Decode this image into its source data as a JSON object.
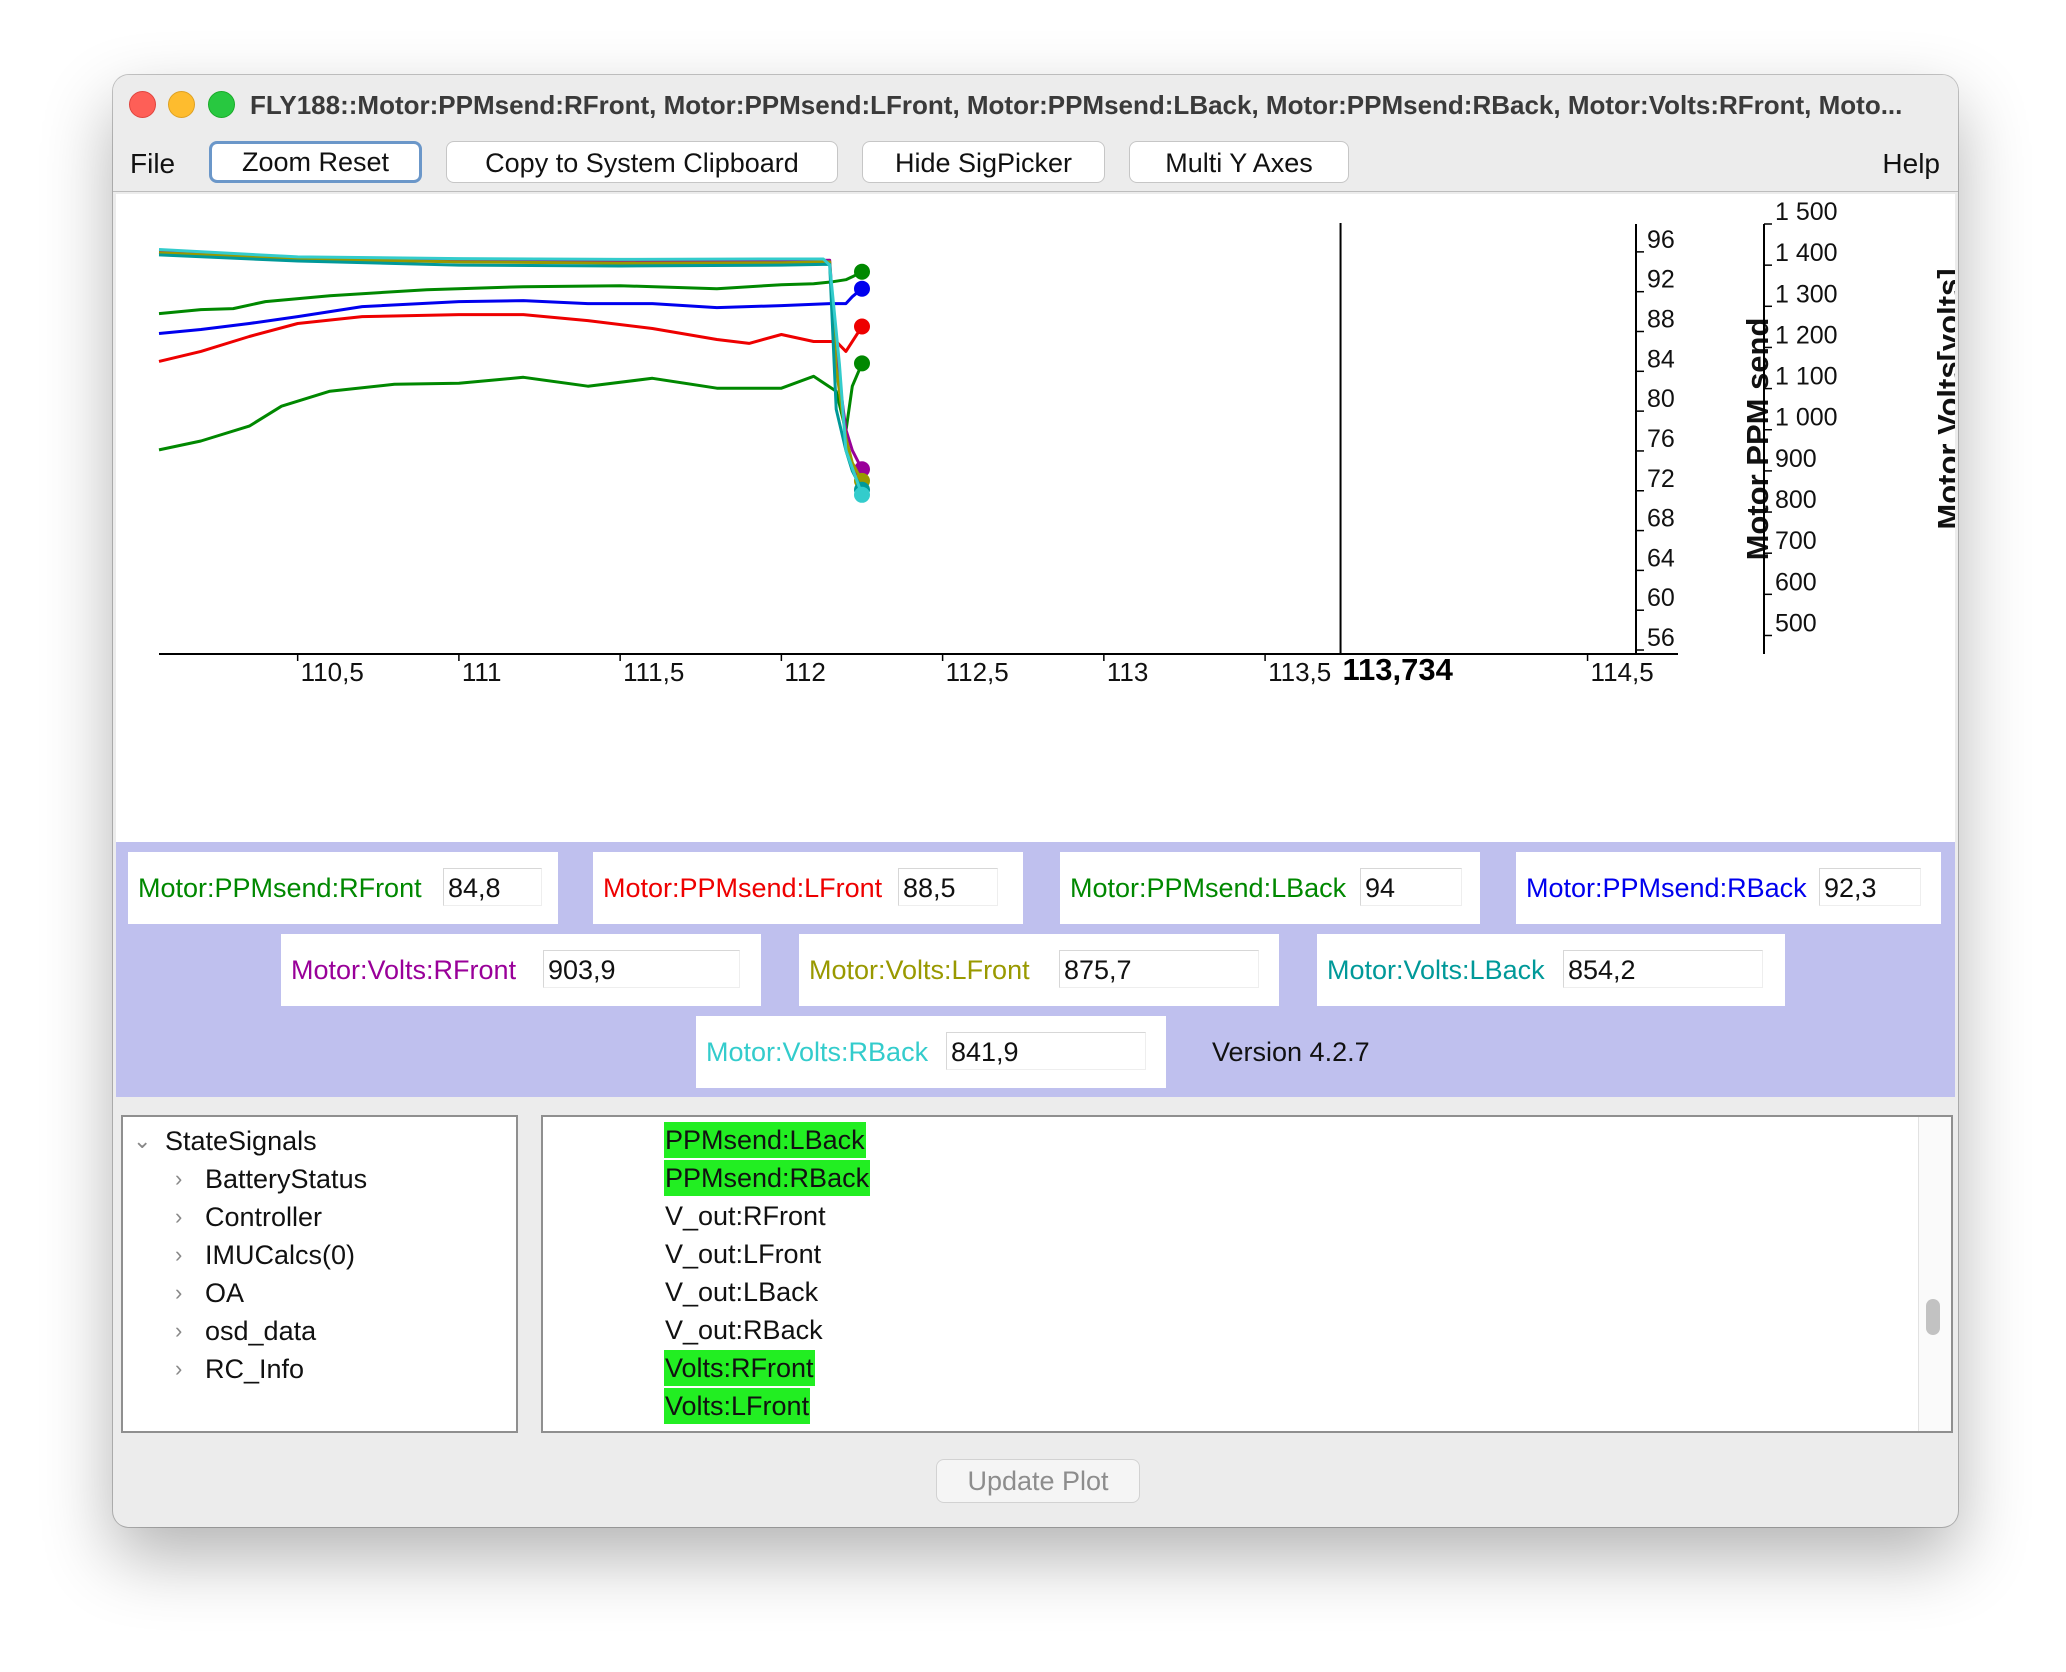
{
  "window": {
    "title": "FLY188::Motor:PPMsend:RFront, Motor:PPMsend:LFront, Motor:PPMsend:LBack, Motor:PPMsend:RBack, Motor:Volts:RFront, Moto..."
  },
  "menubar": {
    "file": "File",
    "help": "Help",
    "buttons": {
      "zoom_reset": "Zoom Reset",
      "copy_clipboard": "Copy to System Clipboard",
      "hide_sigpicker": "Hide SigPicker",
      "multi_y_axes": "Multi Y Axes"
    }
  },
  "chart_data": {
    "type": "line",
    "x_ticks": [
      "110,5",
      "111",
      "111,5",
      "112",
      "112,5",
      "113",
      "113,5",
      "114,5"
    ],
    "cursor_label": "113,734",
    "cursor_x": 113.734,
    "xlim": [
      110.07,
      114.92
    ],
    "y_axes": [
      {
        "label": "Motor PPM send",
        "ticks": [
          "96",
          "92",
          "88",
          "84",
          "80",
          "76",
          "72",
          "68",
          "64",
          "60",
          "56"
        ],
        "ylim": [
          55.6,
          98.8
        ]
      },
      {
        "label": "Motor Volts[volts]",
        "ticks": [
          "1 500",
          "1 400",
          "1 300",
          "1 200",
          "1 100",
          "1 000",
          "900",
          "800",
          "700",
          "600",
          "500"
        ],
        "ylim": [
          455,
          1500
        ]
      }
    ],
    "series": [
      {
        "name": "Motor:PPMsend:RFront",
        "color": "#008800",
        "axis": 0,
        "x": [
          110.07,
          110.2,
          110.35,
          110.45,
          110.6,
          110.8,
          111.0,
          111.2,
          111.4,
          111.6,
          111.8,
          112.0,
          112.1,
          112.17,
          112.2,
          112.22,
          112.25
        ],
        "y": [
          76.1,
          77.0,
          78.5,
          80.5,
          82.0,
          82.7,
          82.8,
          83.4,
          82.5,
          83.3,
          82.3,
          82.3,
          83.5,
          82.0,
          78.0,
          82.5,
          84.8
        ]
      },
      {
        "name": "Motor:PPMsend:LFront",
        "color": "#ee0000",
        "axis": 0,
        "x": [
          110.07,
          110.2,
          110.35,
          110.5,
          110.7,
          111.0,
          111.2,
          111.4,
          111.6,
          111.8,
          111.9,
          112.0,
          112.1,
          112.17,
          112.2,
          112.25
        ],
        "y": [
          85.0,
          86.0,
          87.5,
          88.8,
          89.5,
          89.7,
          89.7,
          89.1,
          88.3,
          87.2,
          86.8,
          87.7,
          87.0,
          87.0,
          86.0,
          88.5
        ]
      },
      {
        "name": "Motor:PPMsend:LBack",
        "color": "#008800",
        "axis": 0,
        "x": [
          110.07,
          110.2,
          110.3,
          110.4,
          110.6,
          110.9,
          111.2,
          111.5,
          111.8,
          112.0,
          112.1,
          112.16,
          112.2,
          112.22,
          112.25
        ],
        "y": [
          89.8,
          90.2,
          90.3,
          91.0,
          91.6,
          92.2,
          92.5,
          92.6,
          92.3,
          92.7,
          92.8,
          93.0,
          93.2,
          93.5,
          94.0
        ]
      },
      {
        "name": "Motor:PPMsend:RBack",
        "color": "#0000ee",
        "axis": 0,
        "x": [
          110.07,
          110.2,
          110.35,
          110.5,
          110.7,
          111.0,
          111.2,
          111.4,
          111.6,
          111.8,
          112.0,
          112.15,
          112.2,
          112.22,
          112.25
        ],
        "y": [
          87.8,
          88.2,
          88.8,
          89.5,
          90.5,
          91.0,
          91.1,
          90.8,
          90.8,
          90.4,
          90.6,
          90.8,
          90.8,
          91.5,
          92.3
        ]
      },
      {
        "name": "Motor:Volts:RFront",
        "color": "#990099",
        "axis": 1,
        "x": [
          110.07,
          110.5,
          111.0,
          111.5,
          112.0,
          112.15,
          112.17,
          112.2,
          112.22,
          112.25
        ],
        "y": [
          1432,
          1418,
          1412,
          1408,
          1410,
          1412,
          1180,
          1000,
          950,
          903.9
        ]
      },
      {
        "name": "Motor:Volts:LFront",
        "color": "#999900",
        "axis": 1,
        "x": [
          110.07,
          110.5,
          111.0,
          111.5,
          112.0,
          112.15,
          112.17,
          112.2,
          112.22,
          112.25
        ],
        "y": [
          1430,
          1415,
          1408,
          1405,
          1406,
          1408,
          1150,
          980,
          920,
          875.7
        ]
      },
      {
        "name": "Motor:Volts:LBack",
        "color": "#009999",
        "axis": 1,
        "x": [
          110.07,
          110.5,
          111.0,
          111.5,
          112.0,
          112.15,
          112.17,
          112.2,
          112.22,
          112.25
        ],
        "y": [
          1425,
          1410,
          1400,
          1398,
          1400,
          1402,
          1050,
          950,
          900,
          854.2
        ]
      },
      {
        "name": "Motor:Volts:RBack",
        "color": "#33cccc",
        "axis": 1,
        "x": [
          110.07,
          110.5,
          111.0,
          111.5,
          112.0,
          112.13,
          112.15,
          112.18,
          112.2,
          112.25
        ],
        "y": [
          1438,
          1420,
          1416,
          1414,
          1415,
          1415,
          1400,
          1160,
          950,
          841.9
        ]
      }
    ]
  },
  "legend": {
    "rows": [
      [
        {
          "name": "Motor:PPMsend:RFront",
          "value": "84,8",
          "color": "#008800"
        },
        {
          "name": "Motor:PPMsend:LFront",
          "value": "88,5",
          "color": "#ee0000"
        },
        {
          "name": "Motor:PPMsend:LBack",
          "value": "94",
          "color": "#008800"
        },
        {
          "name": "Motor:PPMsend:RBack",
          "value": "92,3",
          "color": "#0000ee"
        }
      ],
      [
        {
          "name": "Motor:Volts:RFront",
          "value": "903,9",
          "color": "#990099"
        },
        {
          "name": "Motor:Volts:LFront",
          "value": "875,7",
          "color": "#999900"
        },
        {
          "name": "Motor:Volts:LBack",
          "value": "854,2",
          "color": "#009999"
        }
      ],
      [
        {
          "name": "Motor:Volts:RBack",
          "value": "841,9",
          "color": "#33cccc"
        }
      ]
    ],
    "version": "Version 4.2.7"
  },
  "sigpicker": {
    "tree": {
      "root": "StateSignals",
      "items": [
        "BatteryStatus",
        "Controller",
        "IMUCalcs(0)",
        "OA",
        "osd_data",
        "RC_Info"
      ]
    },
    "signals": [
      {
        "label": "PPMsend:LBack",
        "selected": true
      },
      {
        "label": "PPMsend:RBack",
        "selected": true
      },
      {
        "label": "V_out:RFront",
        "selected": false
      },
      {
        "label": "V_out:LFront",
        "selected": false
      },
      {
        "label": "V_out:LBack",
        "selected": false
      },
      {
        "label": "V_out:RBack",
        "selected": false
      },
      {
        "label": "Volts:RFront",
        "selected": true
      },
      {
        "label": "Volts:LFront",
        "selected": true
      }
    ],
    "update_button": "Update Plot"
  }
}
